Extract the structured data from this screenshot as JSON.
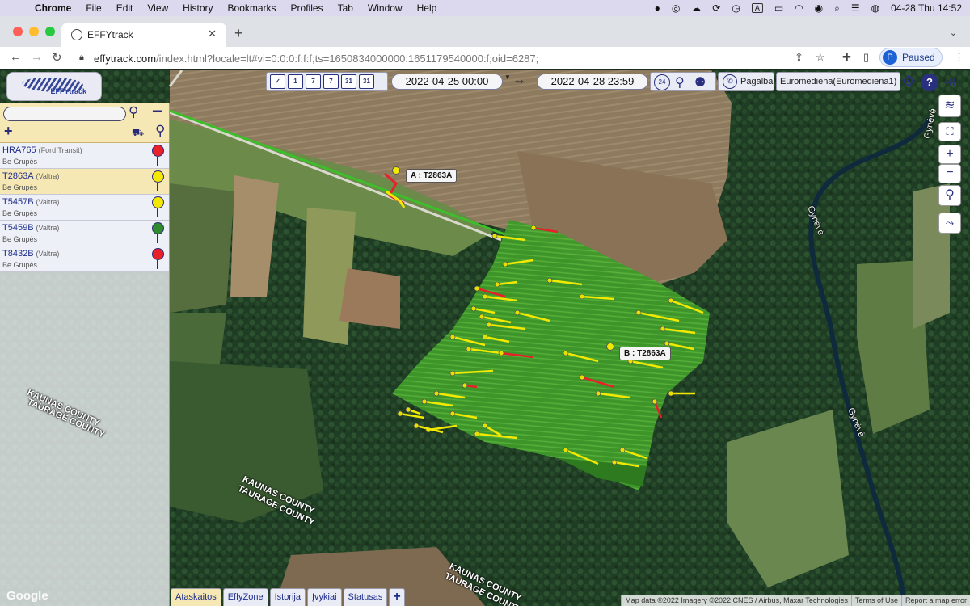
{
  "menubar": {
    "app": "Chrome",
    "items": [
      "File",
      "Edit",
      "View",
      "History",
      "Bookmarks",
      "Profiles",
      "Tab",
      "Window",
      "Help"
    ],
    "clock": "04-28 Thu  14:52"
  },
  "browser": {
    "tab_title": "EFFYtrack",
    "url_host": "effytrack.com",
    "url_rest": "/index.html?locale=lt#vi=0:0:0:f:f:f;ts=1650834000000:1651179540000:f;oid=6287;",
    "profile_initial": "P",
    "profile_status": "Paused"
  },
  "app": {
    "logo_text": "EFFYtrack",
    "date_from": "2022-04-25 00:00",
    "date_to": "2022-04-28 23:59",
    "range_arrows": "⇔",
    "help_label": "Pagalba",
    "user_label": "Euromediena(Euromediena1)",
    "calendar_icons": [
      "1",
      "7",
      "7",
      "31",
      "31"
    ]
  },
  "vehicles": [
    {
      "plate": "HRA765",
      "model": "(Ford Transit)",
      "group": "Be Grupės",
      "status_color": "#e8202a",
      "selected": false
    },
    {
      "plate": "T2863A",
      "model": "(Valtra)",
      "group": "Be Grupės",
      "status_color": "#f2e800",
      "selected": true
    },
    {
      "plate": "T5457B",
      "model": "(Valtra)",
      "group": "Be Grupės",
      "status_color": "#f2e800",
      "selected": false
    },
    {
      "plate": "T5459B",
      "model": "(Valtra)",
      "group": "Be Grupės",
      "status_color": "#2e8b2e",
      "selected": false
    },
    {
      "plate": "T8432B",
      "model": "(Valtra)",
      "group": "Be Grupės",
      "status_color": "#e8202a",
      "selected": false
    }
  ],
  "map": {
    "label_a": "A : T2863A",
    "label_b": "B : T2863A",
    "place_labels": {
      "county1_a": "KAUNAS COUNTY",
      "county1_b": "TAURAGE COUNTY",
      "county2_a": "KAUNAS COUNTY",
      "county2_b": "TAURAGE COUNTY",
      "county3_a": "KAUNAS COUNTY",
      "county3_b": "TAURAGE COUNTY",
      "river1": "Gynėvė",
      "river2": "Gynėvė",
      "river3": "Gynėvė"
    },
    "google": "Google",
    "attribution": "Map data ©2022 Imagery ©2022 CNES / Airbus, Maxar Technologies",
    "terms": "Terms of Use",
    "report": "Report a map error"
  },
  "bottom_tabs": [
    "Ataskaitos",
    "EffyZone",
    "Istorija",
    "Įvykiai",
    "Statusas",
    "+"
  ],
  "colors": {
    "panel_header": "#f6e8b5",
    "accent": "#2a3080",
    "track_green": "#3cbf2a",
    "track_yellow": "#f2e800",
    "track_red": "#e8202a"
  }
}
